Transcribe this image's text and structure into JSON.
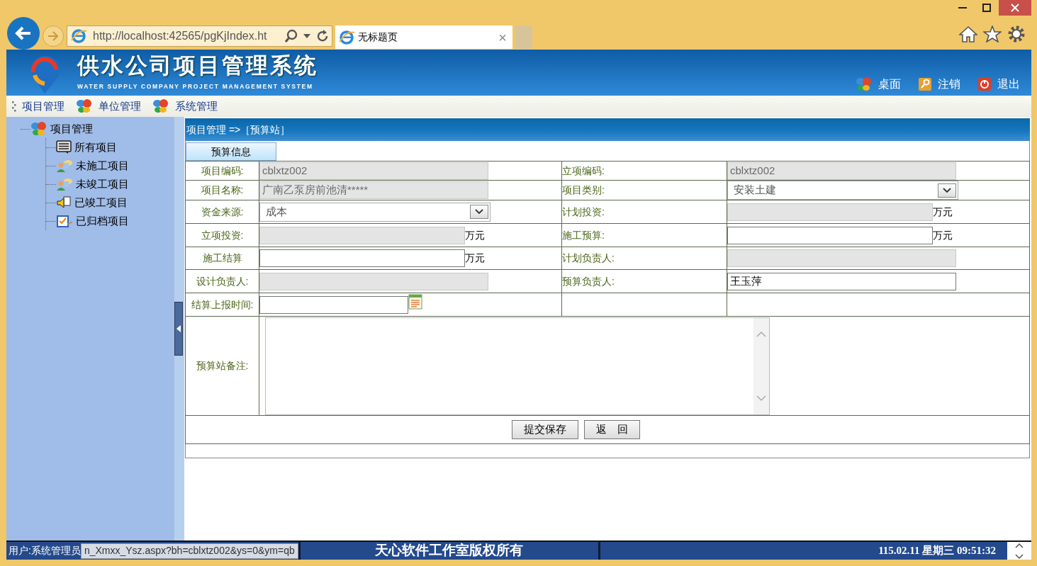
{
  "browser": {
    "url": "http://localhost:42565/pgKjIndex.ht",
    "tab_title": "无标题页",
    "tab_close": "×"
  },
  "header": {
    "title": "供水公司项目管理系统",
    "subtitle": "WATER SUPPLY COMPANY PROJECT MANAGEMENT SYSTEM",
    "links": [
      {
        "label": "桌面",
        "kind": "desktop"
      },
      {
        "label": "注销",
        "kind": "logout"
      },
      {
        "label": "退出",
        "kind": "exit"
      }
    ]
  },
  "menu": [
    {
      "label": "项目管理",
      "kind": "grip"
    },
    {
      "label": "单位管理",
      "kind": "butterfly"
    },
    {
      "label": "系统管理",
      "kind": "butterfly"
    }
  ],
  "sidebar": {
    "tree": [
      {
        "label": "项目管理",
        "kind": "butterfly",
        "children": [
          {
            "label": "所有项目",
            "kind": "list"
          },
          {
            "label": "未施工项目",
            "kind": "people"
          },
          {
            "label": "未竣工项目",
            "kind": "people"
          },
          {
            "label": "已竣工项目",
            "kind": "speaker"
          },
          {
            "label": "已归档项目",
            "kind": "check"
          }
        ]
      }
    ]
  },
  "breadcrumb": "项目管理 =>［预算站］",
  "tabs": [
    {
      "label": "预算信息",
      "selected": true
    }
  ],
  "form": {
    "rows": [
      {
        "cells": [
          {
            "label": "项目编码:",
            "field": {
              "kind": "text",
              "value": "cblxtz002",
              "disabled": true
            }
          },
          {
            "label": "立项编码:",
            "field": {
              "kind": "text",
              "value": "cblxtz002",
              "disabled": true
            }
          }
        ]
      },
      {
        "cells": [
          {
            "label": "项目名称:",
            "field": {
              "kind": "text",
              "value": "广南乙泵房前池清*****",
              "disabled": true
            }
          },
          {
            "label": "项目类别:",
            "field": {
              "kind": "select",
              "value": "安装土建"
            }
          }
        ]
      },
      {
        "cells": [
          {
            "label": "资金来源:",
            "field": {
              "kind": "select",
              "value": "成本"
            }
          },
          {
            "label": "计划投资:",
            "field": {
              "kind": "text",
              "disabled": true,
              "unit": "万元"
            }
          }
        ]
      },
      {
        "cells": [
          {
            "label": "立项投资:",
            "field": {
              "kind": "text",
              "disabled": true,
              "unit": "万元"
            }
          },
          {
            "label": "施工预算:",
            "field": {
              "kind": "text",
              "disabled": false,
              "unit": "万元"
            }
          }
        ]
      },
      {
        "cells": [
          {
            "label": "施工结算",
            "field": {
              "kind": "text",
              "disabled": false,
              "unit": "万元"
            }
          },
          {
            "label": "计划负责人:",
            "field": {
              "kind": "text",
              "disabled": true
            }
          }
        ]
      },
      {
        "cells": [
          {
            "label": "设计负责人:",
            "field": {
              "kind": "text",
              "disabled": true
            }
          },
          {
            "label": "预算负责人:",
            "field": {
              "kind": "text",
              "value": "王玉萍",
              "disabled": false
            }
          }
        ]
      },
      {
        "cells": [
          {
            "label": "结算上报时间:",
            "field": {
              "kind": "date",
              "disabled": false
            }
          },
          {}
        ]
      }
    ],
    "remark_label": "预算站备注:",
    "buttons": [
      "提交保存",
      "返　回"
    ]
  },
  "status_bar": {
    "user": "用户:系统管理员",
    "link_preview": "n_Xmxx_Ysz.aspx?bh=cblxtz002&ys=0&ym=qb",
    "copyright": "天心软件工作室版权所有",
    "datetime": "115.02.11  星期三  09:51:32"
  }
}
